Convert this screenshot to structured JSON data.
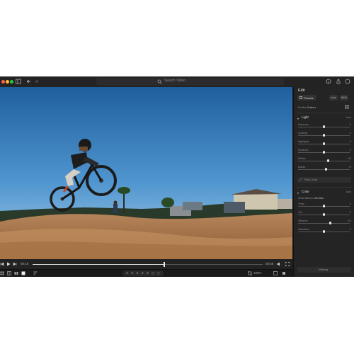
{
  "search": {
    "placeholder": "Search Video"
  },
  "colors": {
    "accent": "#3d8bff",
    "traffic_red": "#ff5f57",
    "traffic_yellow": "#febc2e",
    "traffic_green": "#28c840"
  },
  "playback": {
    "current_time": "00:18",
    "end_time": "00:56",
    "progress_fraction": 0.57
  },
  "toolbar": {
    "rating": "★ ★ ★ ★ ★ ◫ ◫",
    "zoom": "100%"
  },
  "panel": {
    "title": "Edit",
    "presets_label": "Presets",
    "auto_label": "Auto",
    "bw_label": "B&W",
    "profile_label": "Profile",
    "profile_value": "Color",
    "light": {
      "label": "Light",
      "auto": "Auto",
      "sliders": [
        {
          "label": "Exposure",
          "value": "0",
          "position": 0.5
        },
        {
          "label": "Contrast",
          "value": "0",
          "position": 0.5
        },
        {
          "label": "Highlights",
          "value": "0",
          "position": 0.5
        },
        {
          "label": "Shadows",
          "value": "0",
          "position": 0.5
        },
        {
          "label": "Whites",
          "value": "+16",
          "position": 0.58
        },
        {
          "label": "Blacks",
          "value": "+8",
          "position": 0.54
        }
      ],
      "point_curve": "Point Curve"
    },
    "color": {
      "label": "Color",
      "auto": "Auto",
      "white_balance_label": "White Balance",
      "white_balance_value": "As Shot",
      "sliders": [
        {
          "label": "Temp",
          "value": "0",
          "position": 0.5
        },
        {
          "label": "Tint",
          "value": "0",
          "position": 0.5
        },
        {
          "label": "Vibrance",
          "value": "+24",
          "position": 0.62
        },
        {
          "label": "Saturation",
          "value": "0",
          "position": 0.5
        }
      ]
    },
    "footer": "Masking"
  }
}
